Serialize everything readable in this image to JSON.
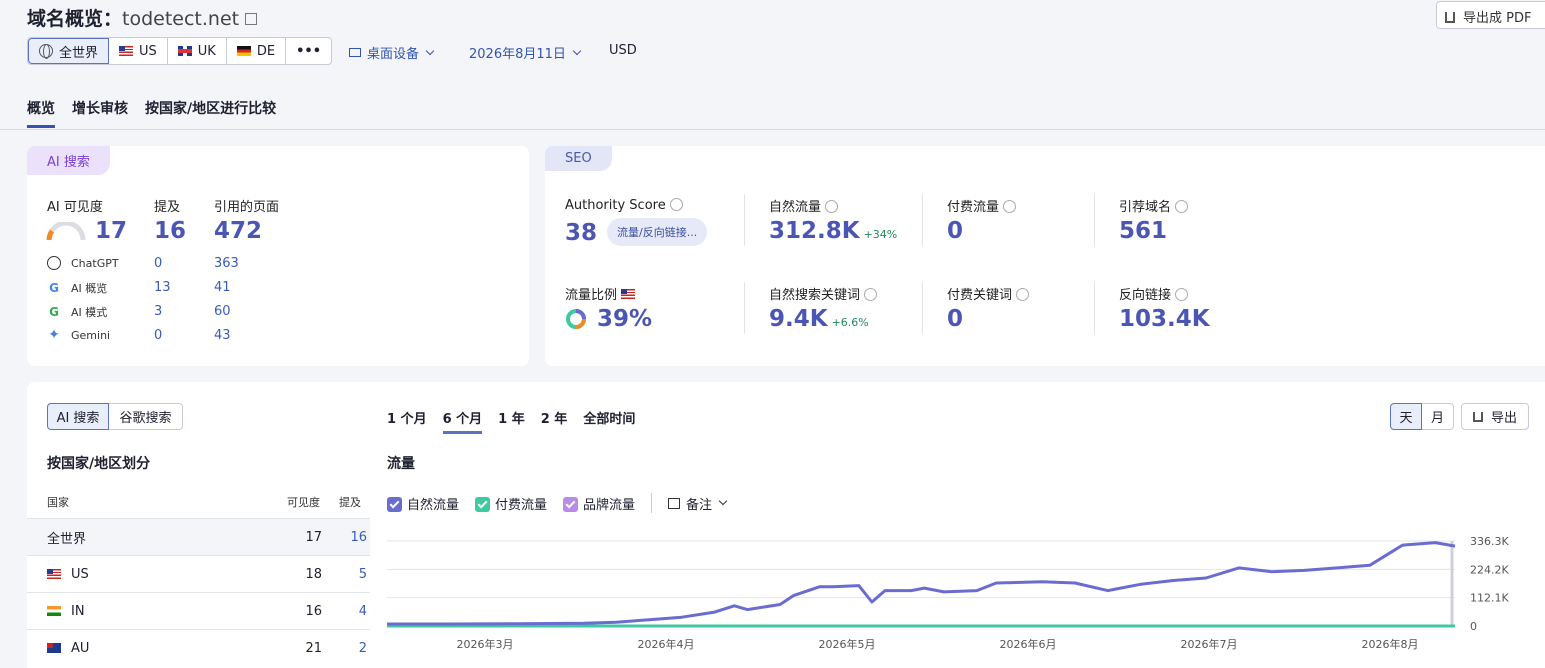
{
  "header": {
    "title_prefix": "域名概览：",
    "domain": "todetect.net",
    "export_pdf": "导出成 PDF"
  },
  "regions": [
    {
      "label": "全世界",
      "active": true
    },
    {
      "label": "US"
    },
    {
      "label": "UK"
    },
    {
      "label": "DE"
    }
  ],
  "more_label": "•••",
  "device": "桌面设备",
  "date": "2026年8月11日",
  "currency": "USD",
  "tabs": [
    "概览",
    "增长审核",
    "按国家/地区进行比较"
  ],
  "ai_card": {
    "badge": "AI 搜索",
    "visibility_label": "AI 可见度",
    "visibility_value": "17",
    "mentions_label": "提及",
    "mentions_value": "16",
    "cited_label": "引用的页面",
    "cited_value": "472",
    "rows": [
      {
        "name": "ChatGPT",
        "mentions": "0",
        "cited": "363",
        "icon": "chatgpt-icon"
      },
      {
        "name": "AI 概览",
        "mentions": "13",
        "cited": "41",
        "icon": "google-icon"
      },
      {
        "name": "AI 模式",
        "mentions": "3",
        "cited": "60",
        "icon": "google-icon"
      },
      {
        "name": "Gemini",
        "mentions": "0",
        "cited": "43",
        "icon": "gemini-icon"
      }
    ]
  },
  "seo_card": {
    "badge": "SEO",
    "authority_label": "Authority Score",
    "authority_value": "38",
    "authority_pill": "流量/反向链接...",
    "organic_label": "自然流量",
    "organic_value": "312.8K",
    "organic_delta": "+34%",
    "paid_label": "付费流量",
    "paid_value": "0",
    "ref_label": "引荐域名",
    "ref_value": "561",
    "share_label": "流量比例",
    "share_value": "39%",
    "organic_kw_label": "自然搜索关键词",
    "organic_kw_value": "9.4K",
    "organic_kw_delta": "+6.6%",
    "paid_kw_label": "付费关键词",
    "paid_kw_value": "0",
    "backlinks_label": "反向链接",
    "backlinks_value": "103.4K"
  },
  "bottom": {
    "toggle": [
      "AI 搜索",
      "谷歌搜索"
    ],
    "ranges": [
      "1 个月",
      "6 个月",
      "1 年",
      "2 年",
      "全部时间"
    ],
    "granularity": [
      "天",
      "月"
    ],
    "export": "导出",
    "country_title": "按国家/地区划分",
    "col_country": "国家",
    "col_visibility": "可见度",
    "col_mentions": "提及",
    "countries": [
      {
        "name": "全世界",
        "visibility": "17",
        "mentions": "16"
      },
      {
        "name": "US",
        "visibility": "18",
        "mentions": "5"
      },
      {
        "name": "IN",
        "visibility": "16",
        "mentions": "4"
      },
      {
        "name": "AU",
        "visibility": "21",
        "mentions": "2"
      }
    ],
    "traffic_title": "流量",
    "legend": [
      "自然流量",
      "付费流量",
      "品牌流量"
    ],
    "notes": "备注"
  },
  "colors": {
    "organic": "#6a6cd0",
    "paid": "#3fc9a0",
    "brand": "#b98be6",
    "accent": "#3354b0"
  },
  "chart_data": {
    "type": "line",
    "x_ticks": [
      "2026年3月",
      "2026年4月",
      "2026年5月",
      "2026年6月",
      "2026年7月",
      "2026年8月"
    ],
    "y_ticks": [
      "336.3K",
      "224.2K",
      "112.1K",
      "0"
    ],
    "ylim": [
      0,
      336300
    ],
    "series": [
      {
        "name": "自然流量",
        "points": [
          [
            0,
            8000
          ],
          [
            0.1,
            8000
          ],
          [
            0.2,
            9000
          ],
          [
            0.3,
            11000
          ],
          [
            0.35,
            15000
          ],
          [
            0.4,
            25000
          ],
          [
            0.45,
            35000
          ],
          [
            0.5,
            55000
          ],
          [
            0.53,
            80000
          ],
          [
            0.55,
            65000
          ],
          [
            0.6,
            85000
          ],
          [
            0.62,
            120000
          ],
          [
            0.66,
            155000
          ],
          [
            0.68,
            155000
          ],
          [
            0.72,
            160000
          ],
          [
            0.74,
            95000
          ],
          [
            0.76,
            140000
          ],
          [
            0.8,
            140000
          ],
          [
            0.82,
            150000
          ],
          [
            0.85,
            135000
          ],
          [
            0.9,
            140000
          ],
          [
            0.93,
            170000
          ],
          [
            1.0,
            175000
          ],
          [
            1.05,
            170000
          ],
          [
            1.1,
            140000
          ],
          [
            1.15,
            165000
          ],
          [
            1.2,
            180000
          ],
          [
            1.25,
            190000
          ],
          [
            1.3,
            230000
          ],
          [
            1.35,
            215000
          ],
          [
            1.4,
            220000
          ],
          [
            1.45,
            230000
          ],
          [
            1.5,
            240000
          ],
          [
            1.55,
            320000
          ],
          [
            1.6,
            330000
          ],
          [
            1.63,
            316000
          ]
        ]
      },
      {
        "name": "付费流量",
        "points": [
          [
            0,
            0
          ],
          [
            1.63,
            0
          ]
        ]
      },
      {
        "name": "品牌流量",
        "points": [
          [
            0,
            0
          ],
          [
            1.63,
            0
          ]
        ]
      }
    ]
  }
}
